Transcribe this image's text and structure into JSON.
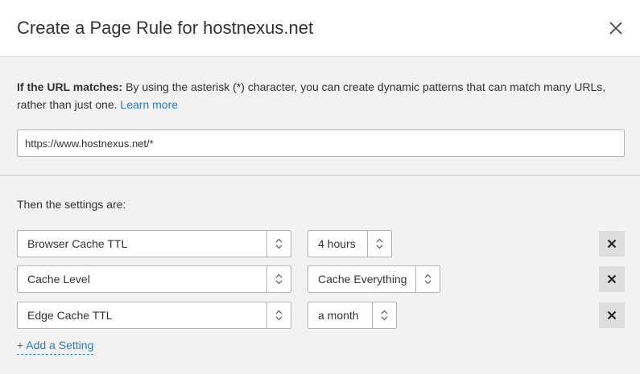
{
  "modal": {
    "title": "Create a Page Rule for hostnexus.net",
    "close_icon": "close-icon"
  },
  "url_section": {
    "intro_bold": "If the URL matches:",
    "intro_text": " By using the asterisk (*) character, you can create dynamic patterns that can match many URLs, rather than just one. ",
    "learn_more": "Learn more",
    "url_value": "https://www.hostnexus.net/*"
  },
  "settings": {
    "label": "Then the settings are:",
    "rows": [
      {
        "setting": "Browser Cache TTL",
        "value": "4 hours"
      },
      {
        "setting": "Cache Level",
        "value": "Cache Everything"
      },
      {
        "setting": "Edge Cache TTL",
        "value": "a month"
      }
    ],
    "add_label": "+ Add a Setting"
  },
  "colors": {
    "link": "#2f7bbf",
    "background": "#f2f2f2",
    "remove_button": "#dedede"
  }
}
